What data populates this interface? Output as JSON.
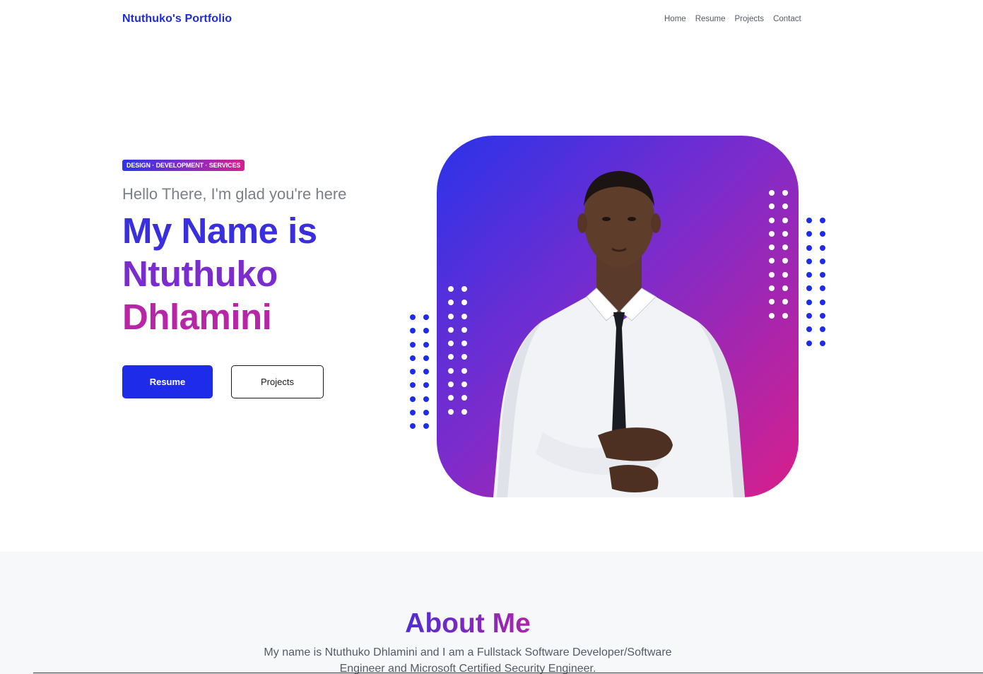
{
  "navbar": {
    "brand": "Ntuthuko's Portfolio",
    "links": [
      "Home",
      "Resume",
      "Projects",
      "Contact"
    ]
  },
  "hero": {
    "badge": "DESIGN · DEVELOPMENT · SERVICES",
    "greeting": "Hello There, I'm glad you're here",
    "headline": [
      "My Name is",
      "Ntuthuko",
      "Dhlamini"
    ],
    "buttons": {
      "primary": "Resume",
      "secondary": "Projects"
    },
    "colors": {
      "accent": "#1e2be8",
      "gradient_start": "#2a33ea",
      "gradient_mid": "#7a2ccd",
      "gradient_end": "#d81f8a"
    }
  },
  "about": {
    "title": "About Me",
    "text": "My name is Ntuthuko Dhlamini and I am a Fullstack Software Developer/Software Engineer and Microsoft Certified Security Engineer."
  }
}
